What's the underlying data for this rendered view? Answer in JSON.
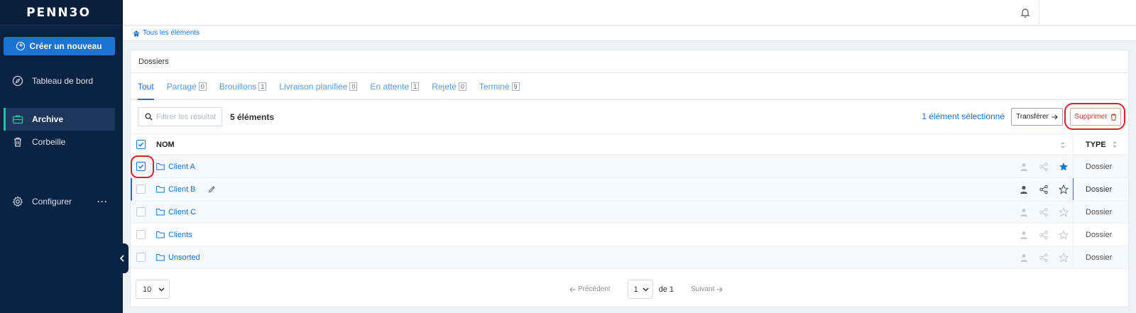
{
  "sidebar": {
    "logo": "PENN3O",
    "create_label": "Créer un nouveau",
    "items": [
      {
        "label": "Tableau de bord",
        "icon": "compass-icon"
      },
      {
        "label": "Archive",
        "icon": "briefcase-icon",
        "active": true
      },
      {
        "label": "Corbeille",
        "icon": "trash-icon"
      },
      {
        "label": "Configurer",
        "icon": "gear-icon",
        "more": "···"
      }
    ]
  },
  "breadcrumb": {
    "label": "Tous les éléments",
    "icon": "home-icon"
  },
  "panel": {
    "title": "Dossiers",
    "tabs": [
      {
        "label": "Tout",
        "count": "",
        "active": true
      },
      {
        "label": "Partagé",
        "count": "0"
      },
      {
        "label": "Brouillons",
        "count": "1"
      },
      {
        "label": "Livraison planifiée",
        "count": "0"
      },
      {
        "label": "En attente",
        "count": "1"
      },
      {
        "label": "Rejeté",
        "count": "0"
      },
      {
        "label": "Terminé",
        "count": "9"
      }
    ],
    "toolbar": {
      "filter_placeholder": "Filtrer les résultat",
      "count_label": "5 éléments",
      "selected_label": "1 élément sélectionné",
      "transfer_label": "Transférer",
      "delete_label": "Supprimer"
    },
    "table": {
      "headers": {
        "name": "NOM",
        "type": "TYPE"
      },
      "rows": [
        {
          "name": "Client A",
          "type": "Dossier",
          "checked": true,
          "starred": true
        },
        {
          "name": "Client B",
          "type": "Dossier",
          "checked": false,
          "starred": false,
          "editable": true
        },
        {
          "name": "Client C",
          "type": "Dossier",
          "checked": false,
          "starred": false
        },
        {
          "name": "Clients",
          "type": "Dossier",
          "checked": false,
          "starred": false
        },
        {
          "name": "Unsorted",
          "type": "Dossier",
          "checked": false,
          "starred": false
        }
      ]
    },
    "footer": {
      "page_size": "10",
      "prev_label": "Précédent",
      "page": "1",
      "of_label": "de 1",
      "next_label": "Suivant"
    }
  },
  "colors": {
    "sidebar_bg": "#0b2241",
    "accent": "#1b73d3",
    "active_marker": "#27c2a0",
    "annotation": "#d9232d"
  }
}
